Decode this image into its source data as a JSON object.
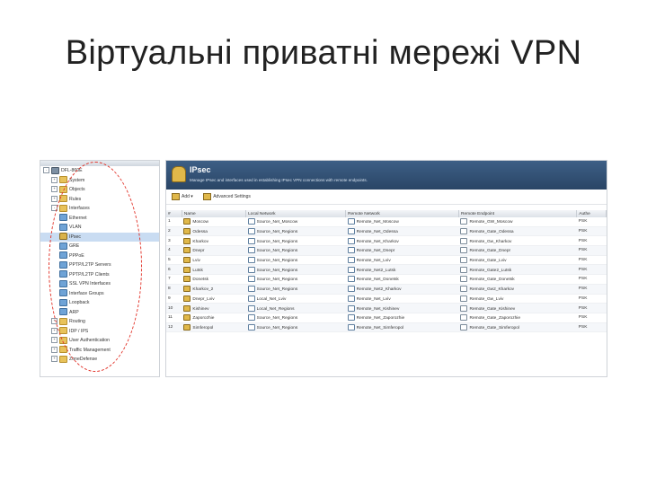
{
  "slide": {
    "title": "Віртуальні приватні мережі VPN"
  },
  "tree": {
    "nodes": [
      {
        "label": "DFL-860E",
        "icon": "root-icon",
        "expander": "-",
        "indent": 0,
        "selected": false
      },
      {
        "label": "System",
        "icon": "folder-icon",
        "expander": "+",
        "indent": 1,
        "selected": false
      },
      {
        "label": "Objects",
        "icon": "folder-icon",
        "expander": "+",
        "indent": 1,
        "selected": false
      },
      {
        "label": "Rules",
        "icon": "folder-icon",
        "expander": "+",
        "indent": 1,
        "selected": false
      },
      {
        "label": "Interfaces",
        "icon": "folder-icon",
        "expander": "-",
        "indent": 1,
        "selected": false
      },
      {
        "label": "Ethernet",
        "icon": "network-icon",
        "expander": "",
        "indent": 2,
        "selected": false
      },
      {
        "label": "VLAN",
        "icon": "network-icon",
        "expander": "",
        "indent": 2,
        "selected": false
      },
      {
        "label": "IPsec",
        "icon": "lock-icon",
        "expander": "",
        "indent": 2,
        "selected": true
      },
      {
        "label": "GRE",
        "icon": "network-icon",
        "expander": "",
        "indent": 2,
        "selected": false
      },
      {
        "label": "PPPoE",
        "icon": "network-icon",
        "expander": "",
        "indent": 2,
        "selected": false
      },
      {
        "label": "PPTP/L2TP Servers",
        "icon": "network-icon",
        "expander": "",
        "indent": 2,
        "selected": false
      },
      {
        "label": "PPTP/L2TP Clients",
        "icon": "network-icon",
        "expander": "",
        "indent": 2,
        "selected": false
      },
      {
        "label": "SSL VPN Interfaces",
        "icon": "network-icon",
        "expander": "",
        "indent": 2,
        "selected": false
      },
      {
        "label": "Interface Groups",
        "icon": "network-icon",
        "expander": "",
        "indent": 2,
        "selected": false
      },
      {
        "label": "Loopback",
        "icon": "network-icon",
        "expander": "",
        "indent": 2,
        "selected": false
      },
      {
        "label": "ARP",
        "icon": "network-icon",
        "expander": "",
        "indent": 2,
        "selected": false
      },
      {
        "label": "Routing",
        "icon": "folder-icon",
        "expander": "+",
        "indent": 1,
        "selected": false
      },
      {
        "label": "IDP / IPS",
        "icon": "folder-icon",
        "expander": "+",
        "indent": 1,
        "selected": false
      },
      {
        "label": "User Authentication",
        "icon": "folder-icon",
        "expander": "+",
        "indent": 1,
        "selected": false
      },
      {
        "label": "Traffic Management",
        "icon": "folder-icon",
        "expander": "+",
        "indent": 1,
        "selected": false
      },
      {
        "label": "ZoneDefense",
        "icon": "folder-icon",
        "expander": "+",
        "indent": 1,
        "selected": false
      }
    ]
  },
  "main": {
    "title": "IPsec",
    "subtitle": "Manage IPsec and interfaces used in establishing IPsec VPN connections with remote endpoints.",
    "toolbar": {
      "add_label": "Add",
      "advanced_label": "Advanced Settings"
    },
    "columns": [
      "#",
      "Name",
      "Local Network",
      "Remote Network",
      "Remote Endpoint",
      "Authe"
    ],
    "rows": [
      [
        "1",
        "Moscow",
        "Source_Net_Moscow",
        "Remote_Net_Moscow",
        "Remote_GW_Moscow",
        "PSK"
      ],
      [
        "2",
        "Odessa",
        "Source_Net_Regions",
        "Remote_Net_Odessa",
        "Remote_Gate_Odessa",
        "PSK"
      ],
      [
        "3",
        "Kharkov",
        "Source_Net_Regions",
        "Remote_Net_Kharkov",
        "Remote_Gw_Kharkov",
        "PSK"
      ],
      [
        "4",
        "Dnepr",
        "Source_Net_Regions",
        "Remote_Net_Dnepr",
        "Remote_Gate_Dnepr",
        "PSK"
      ],
      [
        "5",
        "Lviv",
        "Source_Net_Regions",
        "Remote_Net_Lviv",
        "Remote_Gate_Lviv",
        "PSK"
      ],
      [
        "6",
        "Lutsk",
        "Source_Net_Regions",
        "Remote_Net2_Lutsk",
        "Remote_Gate2_Lutsk",
        "PSK"
      ],
      [
        "7",
        "Donetsk",
        "Source_Net_Regions",
        "Remote_Net_Donetsk",
        "Remote_Gate_Donetsk",
        "PSK"
      ],
      [
        "8",
        "Kharkov_2",
        "Source_Net_Regions",
        "Remote_Net2_Kharkov",
        "Remote_Gw2_Kharkov",
        "PSK"
      ],
      [
        "9",
        "Dnepr_Lviv",
        "Local_Net_Lviv",
        "Remote_Net_Lviv",
        "Remote_Gw_Lviv",
        "PSK"
      ],
      [
        "10",
        "Kishinev",
        "Local_Net_Regions",
        "Remote_Net_Kishinev",
        "Remote_Gate_Kishinev",
        "PSK"
      ],
      [
        "11",
        "Zaporozhie",
        "Source_Net_Regions",
        "Remote_Net_Zaporozhie",
        "Remote_Gate_Zaporozhie",
        "PSK"
      ],
      [
        "12",
        "Simferopol",
        "Source_Net_Regions",
        "Remote_Net_Simferopol",
        "Remote_Gate_Simferopol",
        "PSK"
      ]
    ]
  },
  "colors": {
    "annotation_oval": "#e2342a",
    "header_bg": "#2a4566",
    "selected_bg": "#c9dcf2"
  }
}
